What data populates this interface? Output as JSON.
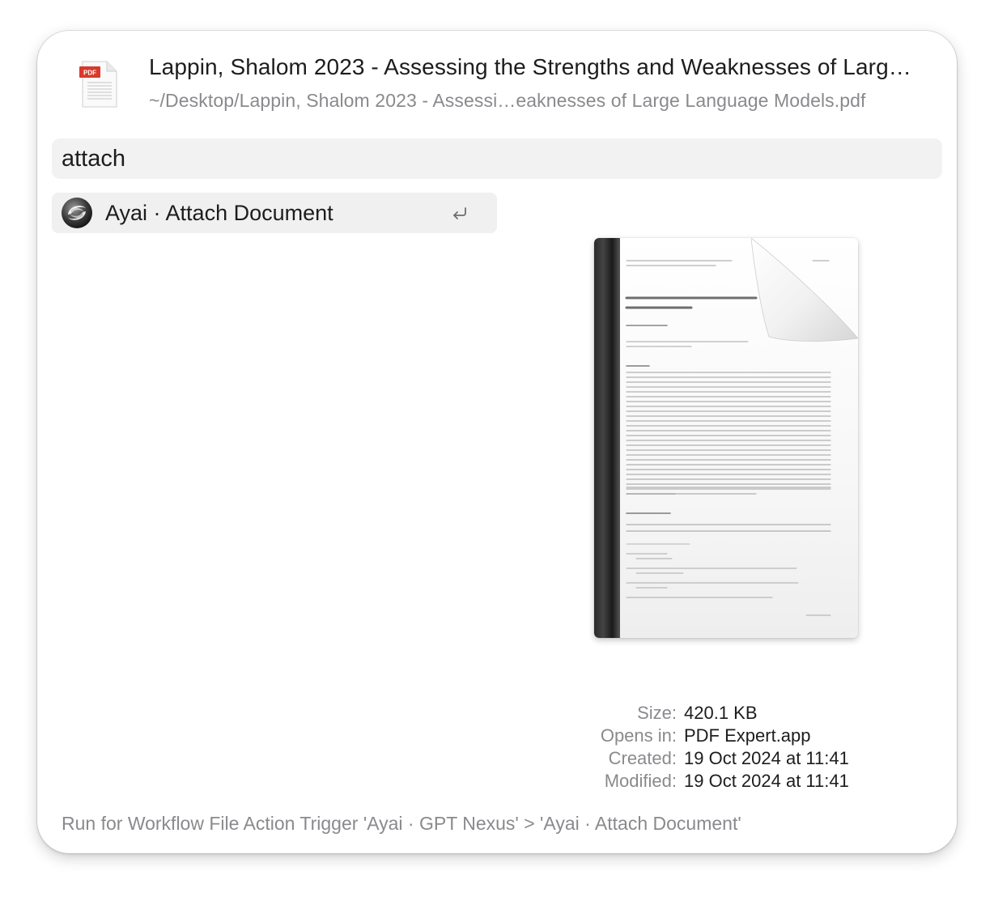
{
  "header": {
    "file_type_badge": "PDF",
    "title": "Lappin, Shalom 2023 - Assessing the Strengths and Weaknesses of Larg…",
    "path": "~/Desktop/Lappin, Shalom 2023 - Assessi…eaknesses of Large Language Models.pdf"
  },
  "search": {
    "query": "attach"
  },
  "results": [
    {
      "label": "Ayai · Attach Document",
      "icon": "ayai-logo-icon",
      "shortcut_icon": "return-key-icon"
    }
  ],
  "preview": {
    "icon": "pdf-document-preview",
    "colors": {
      "spine": "#2a2a2a",
      "page": "#ffffff"
    }
  },
  "metadata": [
    {
      "key": "Size:",
      "value": "420.1 KB"
    },
    {
      "key": "Opens in:",
      "value": "PDF Expert.app"
    },
    {
      "key": "Created:",
      "value": "19 Oct 2024 at 11:41"
    },
    {
      "key": "Modified:",
      "value": "19 Oct 2024 at 11:41"
    }
  ],
  "footer": {
    "text": "Run for Workflow File Action Trigger 'Ayai · GPT Nexus' > 'Ayai · Attach Document'"
  }
}
